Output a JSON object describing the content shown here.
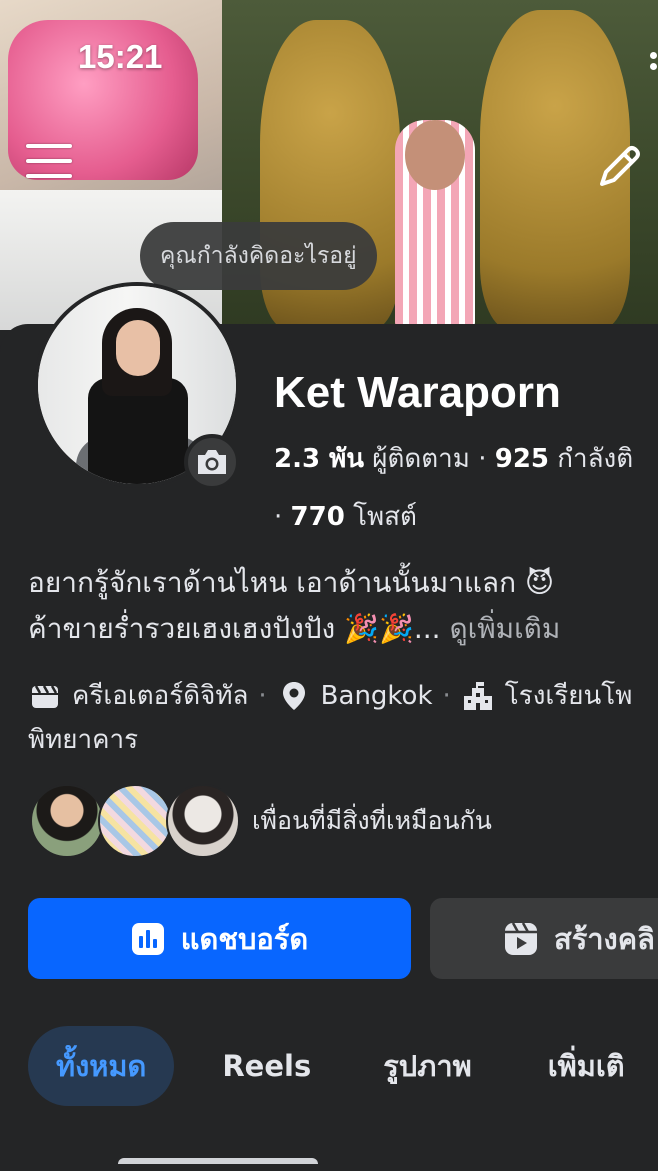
{
  "status_bar": {
    "time": "15:21"
  },
  "cover": {
    "thought_prompt": "คุณกำลังคิดอะไรอยู่"
  },
  "profile": {
    "name": "Ket Waraporn",
    "followers_count": "2.3 พัน",
    "followers_label": "ผู้ติดตาม",
    "following_count": "925",
    "following_label": "กำลังติ",
    "posts_count": "770",
    "posts_label": "โพสต์",
    "separator": "·"
  },
  "bio": {
    "line1": "อยากรู้จักเราด้านไหน เอาด้านนั้นมาแลก 😈",
    "line2": " ค้าขายร่ำรวยเฮงเฮงปังปัง 🎉🎉...",
    "see_more": " ดูเพิ่มเติม"
  },
  "intro": {
    "category": "ครีเอเตอร์ดิจิทัล",
    "location": "Bangkok",
    "school_part1": "โรงเรียนโพ",
    "school_part2": "พิทยาคาร",
    "separator": "·"
  },
  "mutual": {
    "label": "เพื่อนที่มีสิ่งที่เหมือนกัน"
  },
  "actions": {
    "dashboard": "แดชบอร์ด",
    "create": "สร้างคลิ"
  },
  "tabs": [
    "ทั้งหมด",
    "Reels",
    "รูปภาพ",
    "เพิ่มเติ"
  ],
  "colors": {
    "background": "#242526",
    "primary_button": "#0866ff",
    "secondary_button": "#3a3b3c",
    "active_tab_bg": "#263951",
    "active_tab_text": "#4599ff"
  },
  "icons": {
    "menu": "hamburger-icon",
    "edit": "pencil-icon",
    "camera": "camera-icon",
    "category": "clapperboard-icon",
    "location": "location-pin-icon",
    "school": "school-building-icon",
    "dashboard": "bar-chart-icon",
    "create": "reels-icon"
  }
}
